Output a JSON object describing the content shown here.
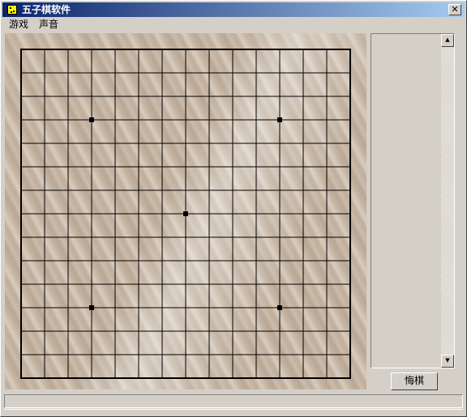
{
  "window": {
    "title": "五子棋软件",
    "close_glyph": "✕"
  },
  "menu": {
    "items": [
      "游戏",
      "声音"
    ]
  },
  "board": {
    "grid_lines": 15,
    "star_points": [
      [
        3,
        3
      ],
      [
        11,
        3
      ],
      [
        7,
        7
      ],
      [
        3,
        11
      ],
      [
        11,
        11
      ]
    ],
    "line_color": "#000000",
    "border_color": "#000000"
  },
  "sidebar": {
    "scroll_up_glyph": "▲",
    "scroll_down_glyph": "▼",
    "undo_label": "悔棋"
  },
  "status": {
    "text": ""
  }
}
